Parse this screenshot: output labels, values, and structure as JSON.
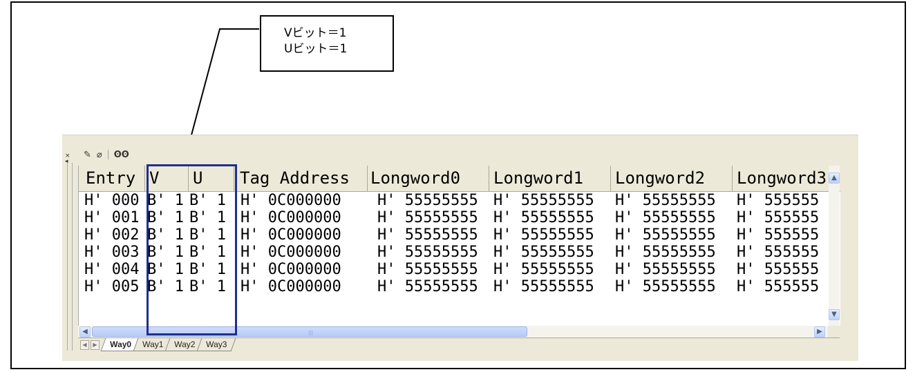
{
  "callout": {
    "line1": "Vビット＝1",
    "line2": "Uビット＝1"
  },
  "toolbar": {
    "close": "×",
    "pencil": "✎",
    "eraser": "⌀",
    "find": "🔭"
  },
  "table": {
    "columns": [
      "Entry",
      "V",
      "U",
      "Tag Address",
      "Longword0",
      "Longword1",
      "Longword2",
      "Longword3"
    ],
    "rows": [
      [
        "H' 000",
        "B' 1",
        "B' 1",
        "H' 0C000000",
        "H' 55555555",
        "H' 55555555",
        "H' 55555555",
        "H' 555555"
      ],
      [
        "H' 001",
        "B' 1",
        "B' 1",
        "H' 0C000000",
        "H' 55555555",
        "H' 55555555",
        "H' 55555555",
        "H' 555555"
      ],
      [
        "H' 002",
        "B' 1",
        "B' 1",
        "H' 0C000000",
        "H' 55555555",
        "H' 55555555",
        "H' 55555555",
        "H' 555555"
      ],
      [
        "H' 003",
        "B' 1",
        "B' 1",
        "H' 0C000000",
        "H' 55555555",
        "H' 55555555",
        "H' 55555555",
        "H' 555555"
      ],
      [
        "H' 004",
        "B' 1",
        "B' 1",
        "H' 0C000000",
        "H' 55555555",
        "H' 55555555",
        "H' 55555555",
        "H' 555555"
      ],
      [
        "H' 005",
        "B' 1",
        "B' 1",
        "H' 0C000000",
        "H' 55555555",
        "H' 55555555",
        "H' 55555555",
        "H' 555555"
      ]
    ]
  },
  "tabs": [
    "Way0",
    "Way1",
    "Way2",
    "Way3"
  ],
  "active_tab": "Way0",
  "colors": {
    "highlight": "#1e2e91",
    "window_bg": "#ece9d8"
  }
}
